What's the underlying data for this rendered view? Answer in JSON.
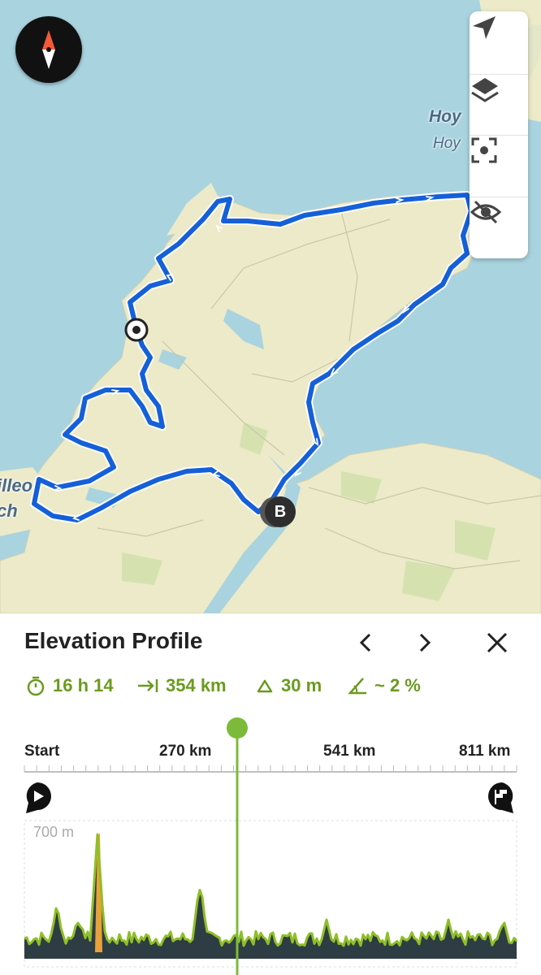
{
  "map": {
    "places": [
      {
        "name": "Hoy",
        "sub": "Hoy"
      }
    ],
    "partial_labels": [
      "illeo",
      "ch"
    ],
    "end_marker_label": "B"
  },
  "controls": [
    {
      "icon": "navigation-arrow-icon"
    },
    {
      "icon": "layers-icon"
    },
    {
      "icon": "focus-icon"
    },
    {
      "icon": "eye-off-icon"
    }
  ],
  "panel": {
    "title": "Elevation Profile",
    "stats": {
      "duration": "16 h 14",
      "distance": "354 km",
      "ascent": "30 m",
      "gradient": "~ 2 %"
    },
    "distance_ticks": [
      "Start",
      "270 km",
      "541 km",
      "811 km"
    ],
    "elevation_label": "700 m",
    "selection_fraction": 0.33
  },
  "colors": {
    "route": "#1560d8",
    "accent": "#6a9b1f",
    "profile_line": "#8fbf28",
    "profile_fill": "#2e3d44",
    "water": "#a9d3df",
    "land": "#eceac8"
  }
}
